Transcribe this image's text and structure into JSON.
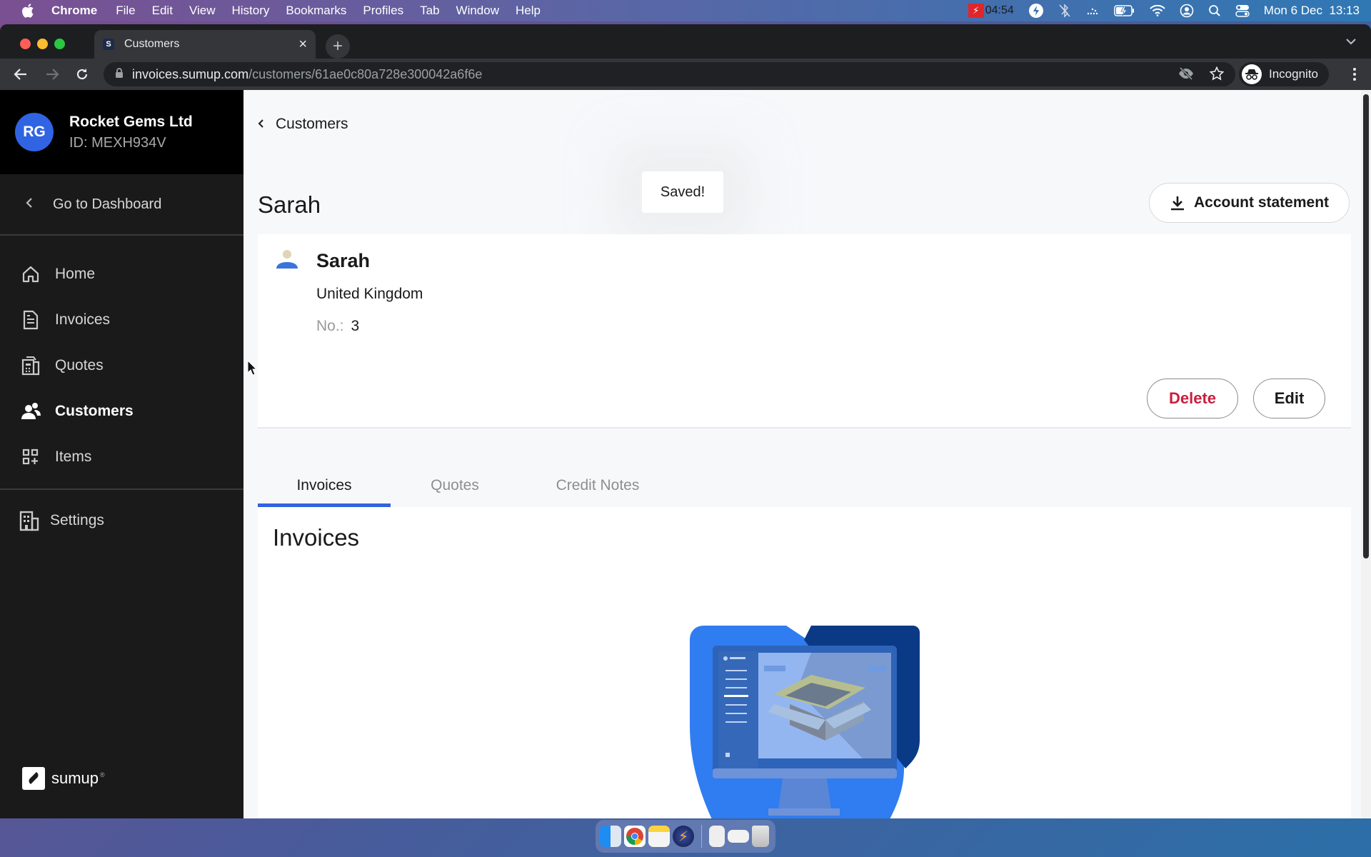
{
  "menubar": {
    "app_name": "Chrome",
    "menus": [
      "File",
      "Edit",
      "View",
      "History",
      "Bookmarks",
      "Profiles",
      "Tab",
      "Window",
      "Help"
    ],
    "recording_time": "04:54",
    "datetime": "Mon 6 Dec  13:13",
    "status_icons": [
      "flash-icon",
      "bluetooth-off-icon",
      "display-icon",
      "battery-charging-icon",
      "wifi-icon",
      "user-icon",
      "spotlight-icon",
      "control-center-icon"
    ]
  },
  "browser": {
    "tab_title": "Customers",
    "url_host": "invoices.sumup.com",
    "url_path": "/customers/61ae0c80a728e300042a6f6e",
    "profile_label": "Incognito"
  },
  "sidebar": {
    "account_initials": "RG",
    "account_name": "Rocket Gems Ltd",
    "account_id": "ID: MEXH934V",
    "dashboard_link": "Go to Dashboard",
    "items": [
      {
        "label": "Home",
        "icon": "home-icon",
        "active": false
      },
      {
        "label": "Invoices",
        "icon": "document-icon",
        "active": false
      },
      {
        "label": "Quotes",
        "icon": "calculator-icon",
        "active": false
      },
      {
        "label": "Customers",
        "icon": "users-icon",
        "active": true
      },
      {
        "label": "Items",
        "icon": "grid-plus-icon",
        "active": false
      }
    ],
    "settings_label": "Settings",
    "logo_text": "sumup"
  },
  "main": {
    "breadcrumb": "Customers",
    "page_title": "Sarah",
    "toast": "Saved!",
    "account_statement_button": "Account statement",
    "customer": {
      "name": "Sarah",
      "country": "United Kingdom",
      "number_label": "No.:",
      "number_value": "3"
    },
    "delete_button": "Delete",
    "edit_button": "Edit",
    "tabs": [
      {
        "label": "Invoices",
        "active": true
      },
      {
        "label": "Quotes",
        "active": false
      },
      {
        "label": "Credit Notes",
        "active": false
      }
    ],
    "panel_title": "Invoices"
  },
  "colors": {
    "accent": "#3063e0",
    "danger": "#c8203f",
    "sidebar_bg": "#1a1a1b"
  },
  "dock": {
    "apps": [
      "Finder",
      "Chrome",
      "Notes",
      "Reeder",
      "Document",
      "Screenshot",
      "Trash"
    ]
  }
}
